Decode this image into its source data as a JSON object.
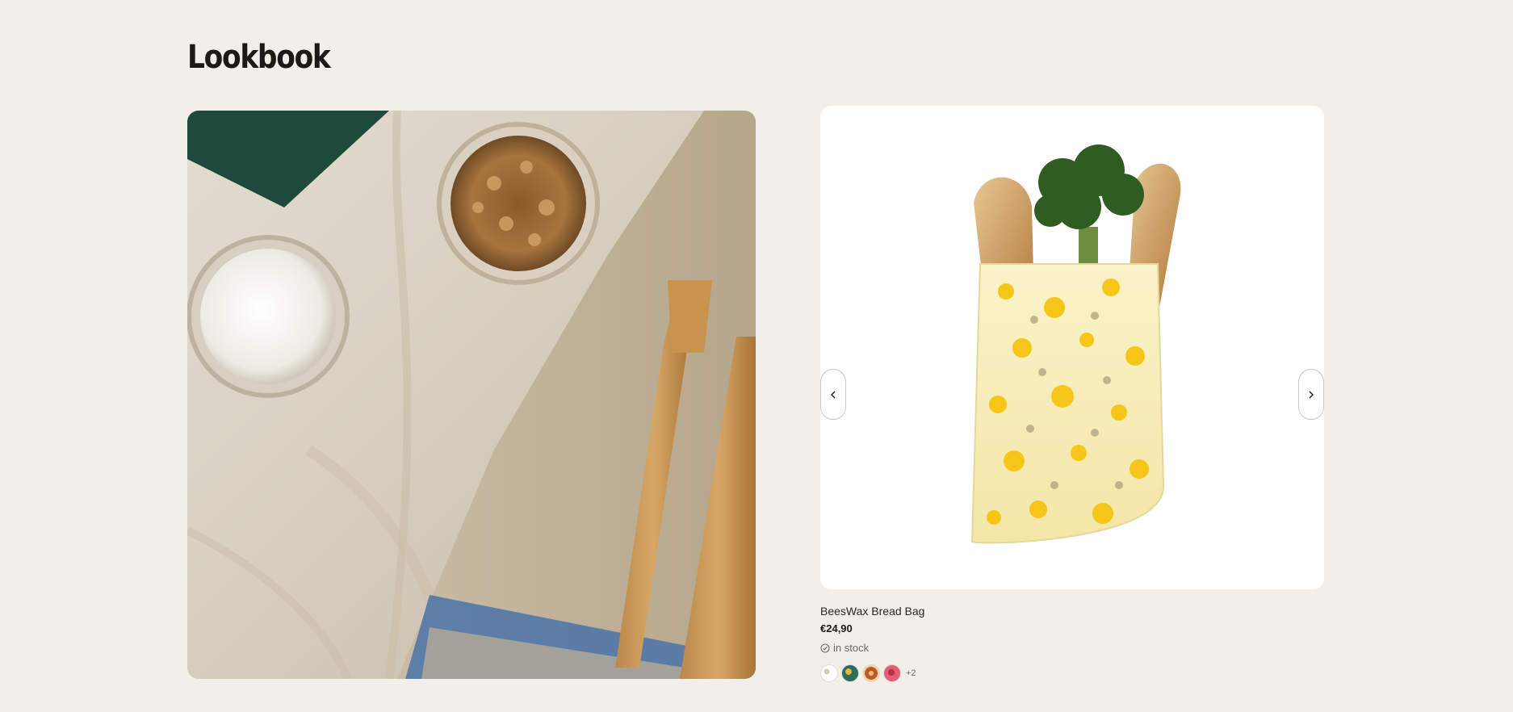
{
  "page": {
    "title": "Lookbook"
  },
  "lookbook": {
    "image_alt": "Linen cloth with yogurt and granola glass bowls, notebook and bamboo cutlery"
  },
  "product": {
    "name": "BeesWax Bread Bag",
    "price": "€24,90",
    "stock_status": "in stock",
    "variants_more": "+2",
    "variants": [
      "white-floral",
      "green-pattern",
      "orange-pattern",
      "pink-pattern"
    ],
    "carousel": {
      "prev_icon": "chevron-left-icon",
      "next_icon": "chevron-right-icon"
    }
  },
  "colors": {
    "background": "#f2efea",
    "card": "#ffffff",
    "text": "#1c1a17"
  }
}
